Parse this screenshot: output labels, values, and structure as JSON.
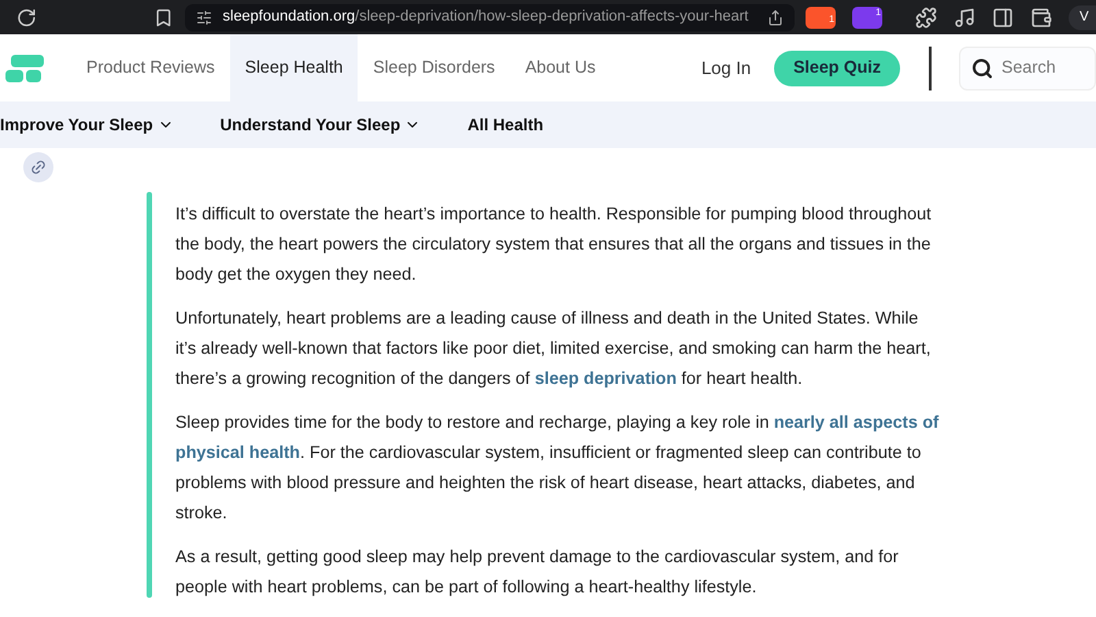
{
  "browser": {
    "domain": "sleepfoundation.org",
    "path": "/sleep-deprivation/how-sleep-deprivation-affects-your-heart",
    "shield_count": "1",
    "rewards_count": "1",
    "profile": "V"
  },
  "nav": {
    "items": [
      {
        "label": "Product Reviews",
        "selected": false
      },
      {
        "label": "Sleep Health",
        "selected": true
      },
      {
        "label": "Sleep Disorders",
        "selected": false
      },
      {
        "label": "About Us",
        "selected": false
      }
    ],
    "login": "Log In",
    "quiz": "Sleep Quiz",
    "search": {
      "placeholder": "Search"
    }
  },
  "subnav": [
    {
      "label": "Improve Your Sleep",
      "dropdown": true
    },
    {
      "label": "Understand Your Sleep",
      "dropdown": true
    },
    {
      "label": "All Health",
      "dropdown": false
    }
  ],
  "article": {
    "paragraphs": [
      [
        {
          "kind": "text",
          "text": "It’s difficult to overstate the heart’s importance to health. Responsible for pumping blood throughout the body, the heart powers the circulatory system that ensures that all the organs and tissues in the body get the oxygen they need."
        }
      ],
      [
        {
          "kind": "text",
          "text": "Unfortunately, heart problems are a leading cause of illness and death in the United States. While it’s already well-known that factors like poor diet, limited exercise, and smoking can harm the heart, there’s a growing recognition of the dangers of "
        },
        {
          "kind": "link",
          "text": "sleep deprivation"
        },
        {
          "kind": "text",
          "text": " for heart health."
        }
      ],
      [
        {
          "kind": "text",
          "text": "Sleep provides time for the body to restore and recharge, playing a key role in "
        },
        {
          "kind": "link",
          "text": "nearly all aspects of"
        },
        {
          "kind": "space"
        },
        {
          "kind": "link",
          "text": "physical health"
        },
        {
          "kind": "text",
          "text": ". For the cardiovascular system, insufficient or fragmented sleep can contribute to problems with blood pressure and heighten the risk of heart disease, heart attacks, diabetes, and stroke."
        }
      ],
      [
        {
          "kind": "text",
          "text": "As a result, getting good sleep may help prevent damage to the cardiovascular system, and for people with heart problems, can be part of following a heart-healthy lifestyle."
        }
      ]
    ]
  }
}
